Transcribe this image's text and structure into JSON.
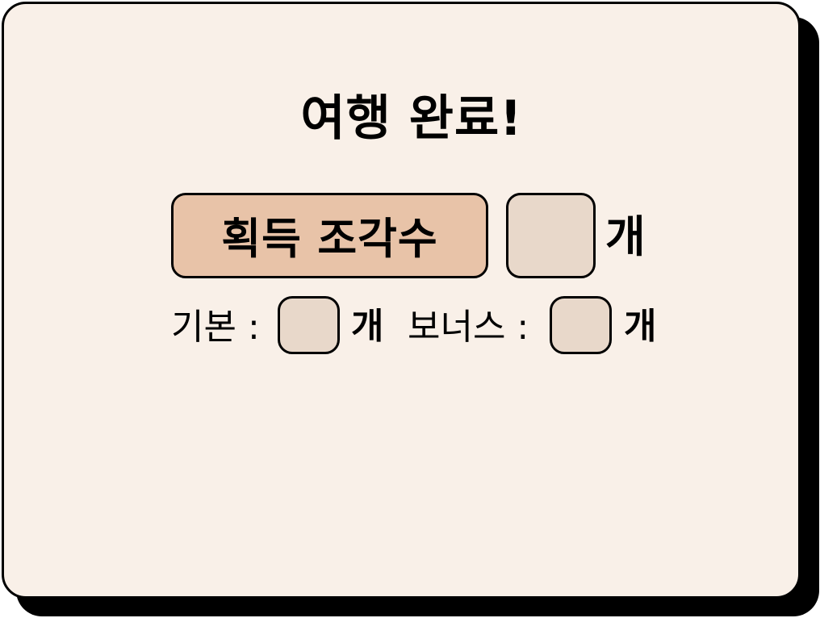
{
  "dialog": {
    "title": "여행 완료!",
    "total": {
      "label": "획득 조각수",
      "value": "",
      "unit": "개"
    },
    "base": {
      "label": "기본 :",
      "value": "",
      "unit": "개"
    },
    "bonus": {
      "label": "보너스 :",
      "value": "",
      "unit": "개"
    }
  },
  "colors": {
    "background": "#f9f0e8",
    "label_box": "#e8c3a8",
    "value_box": "#e8d8ca",
    "border": "#000000"
  }
}
